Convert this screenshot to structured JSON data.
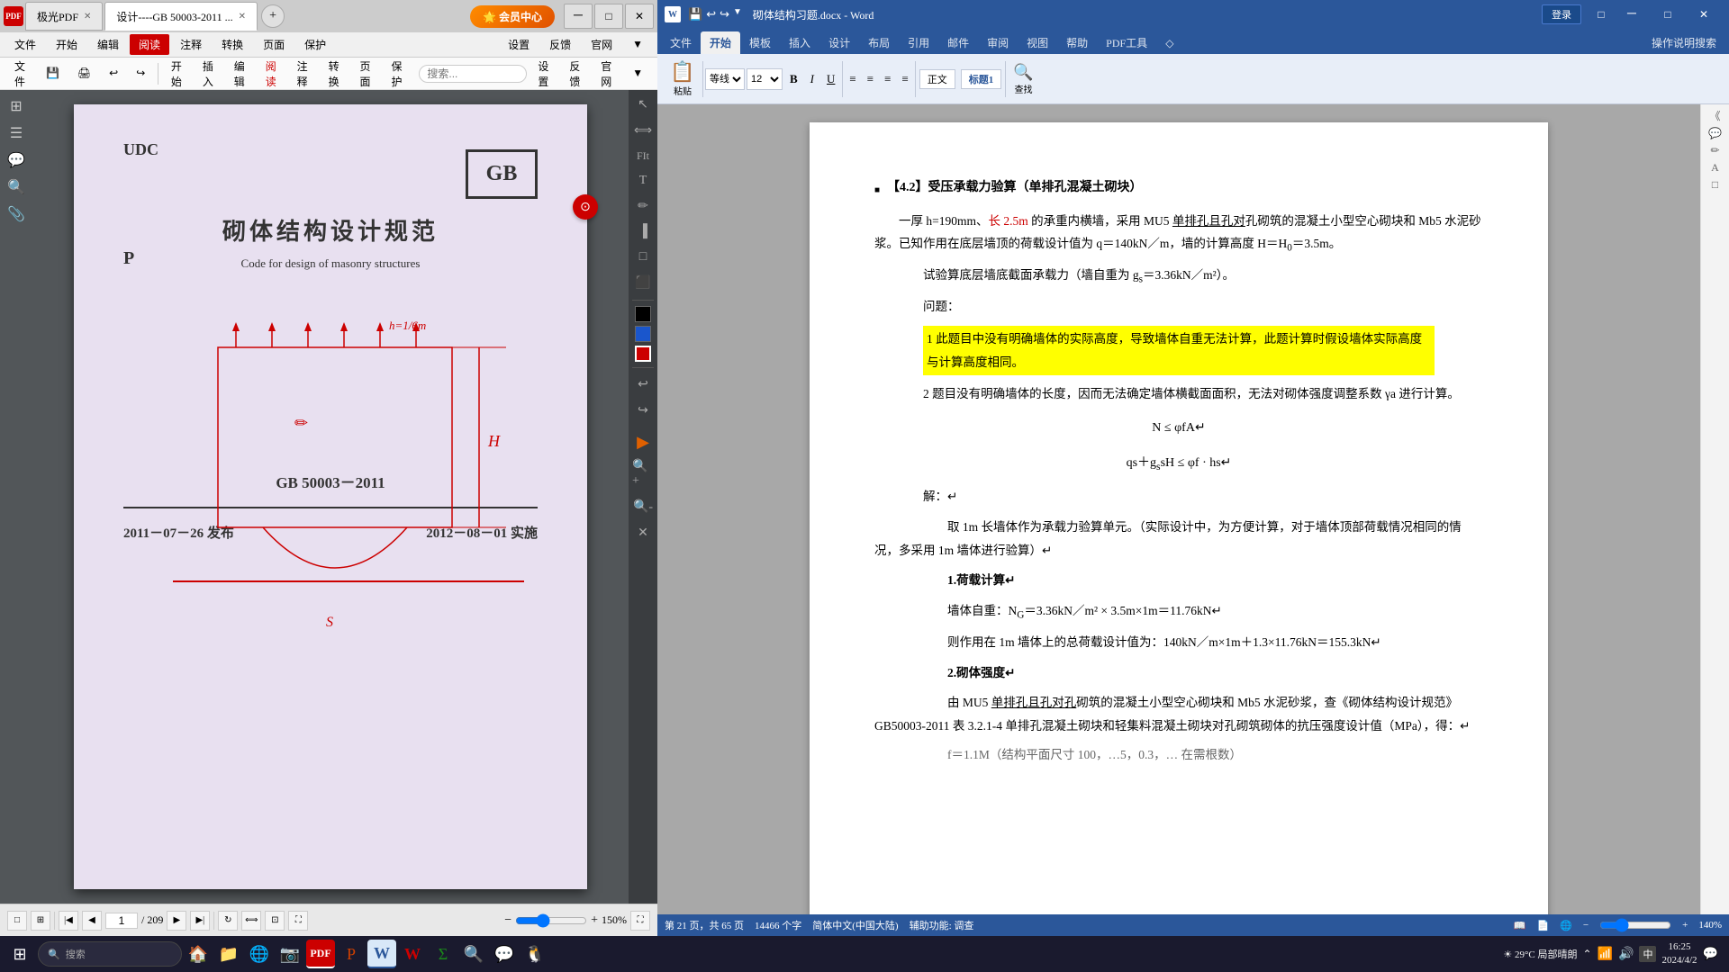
{
  "pdf_app": {
    "title": "极光PDF",
    "tabs": [
      {
        "label": "极光PDF",
        "active": false
      },
      {
        "label": "设计----GB 50003-2011 ...",
        "active": true
      }
    ],
    "ribbon_tabs": [
      "文件",
      "开始",
      "编辑",
      "阅读",
      "注释",
      "转换",
      "页面",
      "保护",
      "设置",
      "反馈",
      "官网"
    ],
    "active_ribbon_tab": "阅读",
    "search_placeholder": "搜索...",
    "page_current": "1",
    "page_total": "209",
    "zoom": "150%",
    "content": {
      "udc": "UDC",
      "p_marker": "P",
      "gb_number": "GB 50003－2011",
      "title_zh": "砌体结构设计规范",
      "title_en": "Code for design of masonry structures",
      "date_issued": "2011－07－26  发布",
      "date_effective": "2012－08－01  实施"
    }
  },
  "word_app": {
    "title": "砌体结构习题.docx - Word",
    "ribbon_tabs": [
      "文件",
      "开始",
      "模板",
      "插入",
      "设计",
      "布局",
      "引用",
      "邮件",
      "审阅",
      "视图",
      "帮助",
      "PDF工具",
      "◇",
      "操作说明搜索"
    ],
    "active_ribbon_tab": "开始",
    "status": {
      "page_info": "第 21 页，共 65 页",
      "word_count": "14466 个字",
      "language": "简体中文(中国大陆)",
      "accessibility": "辅助功能: 调查",
      "zoom": "140%"
    },
    "content": {
      "section_heading": "【4.2】受压承载力验算（单排孔混凝土砌块）",
      "para1": "一厚 h=190mm、长 2.5m 的承重内横墙，采用 MU5 单排孔且孔对孔砌筑的混凝土小型空心砌块和 Mb5 水泥砂浆。已知作用在底层墙顶的荷载设计值为 q＝140kN／m，墙的计算高度 H＝H₀＝3.5m。",
      "para2": "试验算底层墙底截面承载力（墙自重为 g_s＝3.36kN／m²）。",
      "para3": "问题：",
      "note1": "1 此题目中没有明确墙体的实际高度，导致墙体自重无法计算，此题计算时假设墙体实际高度与计算高度相同。",
      "note2": "2 题目没有明确墙体的长度，因而无法确定墙体横截面面积，无法对砌体强度调整系数 γa 进行计算。",
      "formula1": "N ≤ φfA",
      "formula2": "qs＋g_s sH ≤ φf · hs",
      "jie": "解：",
      "step1_title": "取 1m 长墙体作为承载力验算单元。（实际设计中，为方便计算，对于墙体顶部荷载情况相同的情况，多采用 1m 墙体进行验算）",
      "step2_title": "1.荷载计算",
      "step2_content": "墙体自重：N_G＝3.36kN／m² × 3.5m×1m＝11.76kN",
      "step3_content": "则作用在 1m 墙体上的总荷载设计值为：140kN／m×1m＋1.3×11.76kN＝155.3kN",
      "step4_title": "2.砌体强度",
      "step4_content": "由 MU5 单排孔且孔对孔砌筑的混凝土小型空心砌块和 Mb5 水泥砂浆，查《砌体结构设计规范》GB50003-2011 表 3.2.1-4 单排孔混凝土砌块和轻集料混凝土砌块对孔砌筑砌体的抗压强度设计值（MPa），得：",
      "step5_content": "f＝1.1M（结构平面尺寸 100，...5，0.3，…  在需根数）"
    }
  },
  "windows": {
    "taskbar_items": [
      {
        "label": "搜索",
        "icon": "🔍"
      },
      {
        "label": "",
        "icon": "🏠"
      },
      {
        "label": "",
        "icon": "📁"
      },
      {
        "label": "",
        "icon": "🌐"
      },
      {
        "label": "",
        "icon": "📷"
      },
      {
        "label": "",
        "icon": "🎯"
      },
      {
        "label": "",
        "icon": "🔷"
      },
      {
        "label": "",
        "icon": "W"
      },
      {
        "label": "",
        "icon": "🅆"
      },
      {
        "label": "",
        "icon": "🐧"
      }
    ],
    "clock": "16:25",
    "date": "2024/4/2",
    "temp": "29°C 局部晴朗"
  }
}
